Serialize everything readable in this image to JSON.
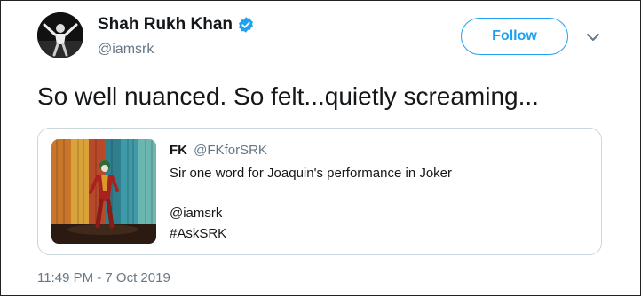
{
  "author": {
    "name": "Shah Rukh Khan",
    "handle": "@iamsrk",
    "verified": true
  },
  "follow_button": {
    "label": "Follow"
  },
  "tweet": {
    "text": "So well nuanced. So felt...quietly screaming..."
  },
  "quoted_tweet": {
    "name": "FK",
    "handle": "@FKforSRK",
    "lines": [
      "Sir one word for Joaquin's performance in Joker",
      "@iamsrk",
      "#AskSRK"
    ]
  },
  "timestamp": "11:49 PM - 7 Oct 2019",
  "colors": {
    "accent": "#1da1f2",
    "secondary_text": "#657786",
    "border": "#ccd6dd"
  },
  "icons": {
    "verified": "verified-badge-icon",
    "more": "chevron-down-icon"
  }
}
